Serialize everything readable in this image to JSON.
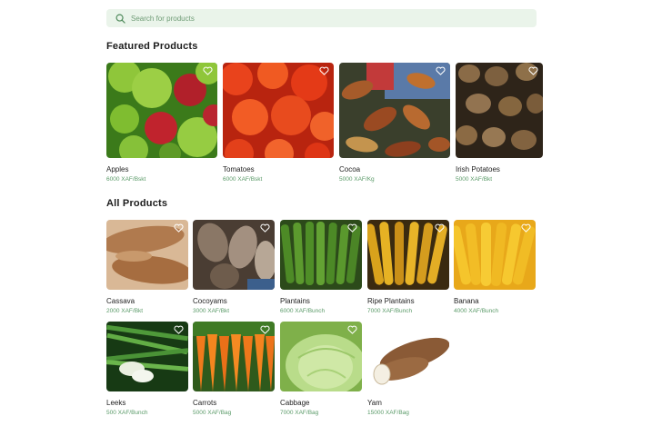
{
  "search": {
    "placeholder": "Search for products"
  },
  "featured": {
    "title": "Featured Products",
    "items": [
      {
        "name": "Apples",
        "price": "6000 XAF/Bskt"
      },
      {
        "name": "Tomatoes",
        "price": "6000 XAF/Bskt"
      },
      {
        "name": "Cocoa",
        "price": "5000 XAF/Kg"
      },
      {
        "name": "Irish Potatoes",
        "price": "5000 XAF/Bkt"
      }
    ]
  },
  "all": {
    "title": "All Products",
    "items": [
      {
        "name": "Cassava",
        "price": "2000 XAF/Bkt"
      },
      {
        "name": "Cocoyams",
        "price": "3000 XAF/Bkt"
      },
      {
        "name": "Plantains",
        "price": "6000 XAF/Bunch"
      },
      {
        "name": "Ripe Plantains",
        "price": "7000 XAF/Bunch"
      },
      {
        "name": "Banana",
        "price": "4000 XAF/Bunch"
      },
      {
        "name": "Leeks",
        "price": "500 XAF/Bunch"
      },
      {
        "name": "Carrots",
        "price": "5000 XAF/Bag"
      },
      {
        "name": "Cabbage",
        "price": "7000 XAF/Bag"
      },
      {
        "name": "Yam",
        "price": "15000 XAF/Bag"
      }
    ]
  },
  "icons": {
    "search": "search-icon",
    "favorite": "heart-outline-icon"
  },
  "colors": {
    "accent": "#5a9a68",
    "search_bg": "#eaf4ea"
  }
}
